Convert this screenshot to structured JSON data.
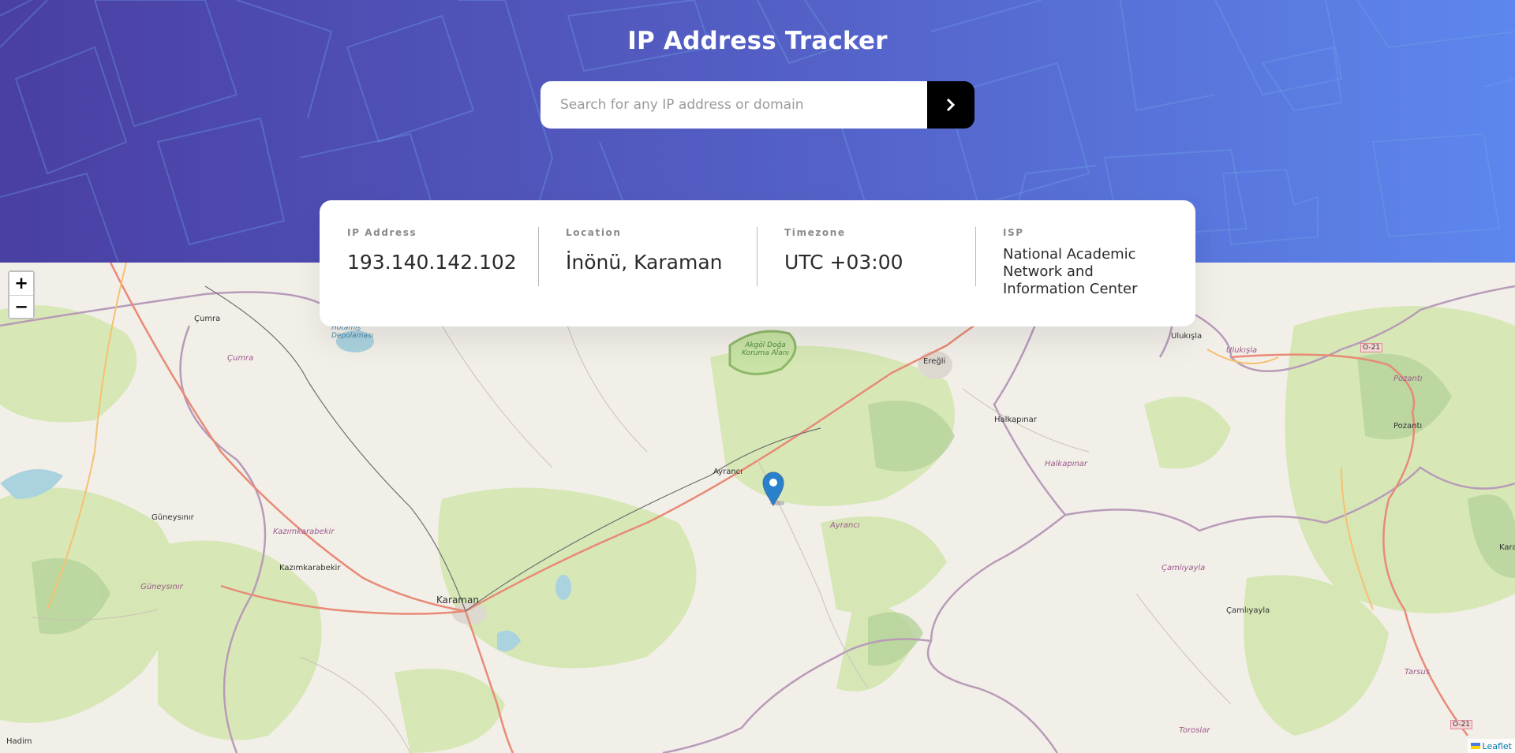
{
  "header": {
    "title": "IP Address Tracker",
    "search_placeholder": "Search for any IP address or domain",
    "search_value": "",
    "submit_icon": "chevron-right-icon"
  },
  "info": {
    "ip_label": "IP Address",
    "ip_value": "193.140.142.102",
    "location_label": "Location",
    "location_value": "İnönü, Karaman",
    "timezone_label": "Timezone",
    "timezone_value": "UTC +03:00",
    "isp_label": "ISP",
    "isp_value": "National Academic Network and Information Center"
  },
  "map": {
    "zoom_in": "+",
    "zoom_out": "−",
    "attribution": "Leaflet",
    "marker_icon": "map-pin-icon",
    "labels": {
      "cumra": "Çumra",
      "cumra_it": "Çumra",
      "hotamis": "Hotamış Depolaması",
      "akgol": "Akgöl Doğa Koruma Alanı",
      "eregli": "Ereğli",
      "ulukisla": "Ulukışla",
      "ulukisla_it": "Ulukışla",
      "o21_top": "O-21",
      "o21_bottom": "O-21",
      "halkapinar": "Halkapınar",
      "halkapinar_it": "Halkapınar",
      "pozanti": "Pozantı",
      "pozanti_it": "Pozantı",
      "ayranci": "Ayrancı",
      "ayranci_it": "Ayrancı",
      "guneysinir": "Güneysınır",
      "guneysinir_it": "Güneysınır",
      "kazimkarabekir_it": "Kazımkarabekir",
      "kazimkarabekir": "Kazımkarabekir",
      "karaman": "Karaman",
      "camliyayla_it": "Çamlıyayla",
      "camliyayla": "Çamlıyayla",
      "tarsus_it": "Tarsus",
      "toroslar_it": "Toroslar",
      "hadim": "Hadim",
      "kara": "Kara"
    }
  },
  "colors": {
    "header_start": "#4a3fa3",
    "header_end": "#5d87ee",
    "button_bg": "#000000",
    "text_dark": "#2b2b2b",
    "text_label": "#8a8a8a",
    "marker": "#2a81cb"
  }
}
